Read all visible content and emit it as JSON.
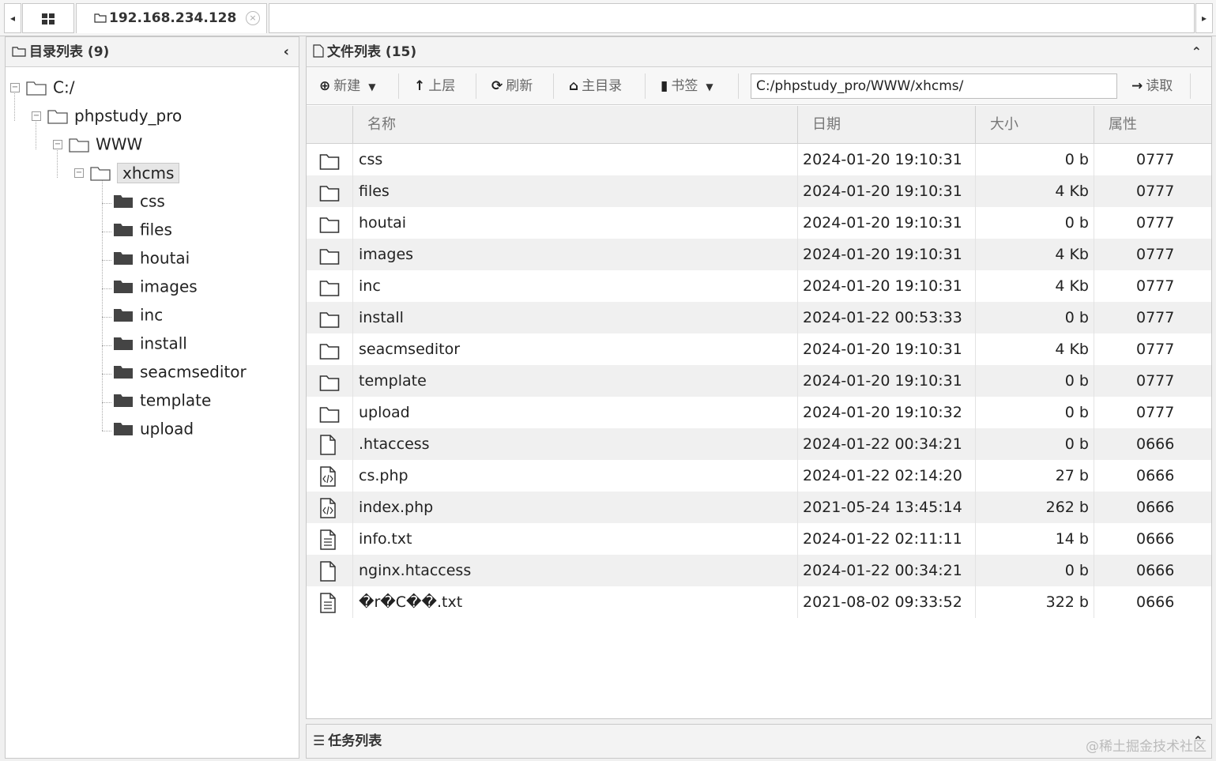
{
  "tabbar": {
    "scroll_left": "◂",
    "scroll_right": "▸",
    "home_icon": "grid-icon",
    "tab_label": "192.168.234.128",
    "tab_close": "×"
  },
  "dir_panel": {
    "title": "目录列表 (9)",
    "collapse": "‹"
  },
  "tree": {
    "root": "C:/",
    "level1": "phpstudy_pro",
    "level2": "WWW",
    "level3": "xhcms",
    "children": [
      "css",
      "files",
      "houtai",
      "images",
      "inc",
      "install",
      "seacmseditor",
      "template",
      "upload"
    ]
  },
  "file_panel": {
    "title": "文件列表 (15)",
    "collapse": "⌃"
  },
  "toolbar": {
    "new_label": "新建",
    "up_label": "上层",
    "refresh_label": "刷新",
    "home_label": "主目录",
    "bookmark_label": "书签",
    "path_value": "C:/phpstudy_pro/WWW/xhcms/",
    "read_label": "读取"
  },
  "columns": {
    "name": "名称",
    "date": "日期",
    "size": "大小",
    "attr": "属性"
  },
  "files": [
    {
      "type": "folder",
      "name": "css",
      "date": "2024-01-20 19:10:31",
      "size": "0 b",
      "attr": "0777"
    },
    {
      "type": "folder",
      "name": "files",
      "date": "2024-01-20 19:10:31",
      "size": "4 Kb",
      "attr": "0777"
    },
    {
      "type": "folder",
      "name": "houtai",
      "date": "2024-01-20 19:10:31",
      "size": "0 b",
      "attr": "0777"
    },
    {
      "type": "folder",
      "name": "images",
      "date": "2024-01-20 19:10:31",
      "size": "4 Kb",
      "attr": "0777"
    },
    {
      "type": "folder",
      "name": "inc",
      "date": "2024-01-20 19:10:31",
      "size": "4 Kb",
      "attr": "0777"
    },
    {
      "type": "folder",
      "name": "install",
      "date": "2024-01-22 00:53:33",
      "size": "0 b",
      "attr": "0777"
    },
    {
      "type": "folder",
      "name": "seacmseditor",
      "date": "2024-01-20 19:10:31",
      "size": "4 Kb",
      "attr": "0777"
    },
    {
      "type": "folder",
      "name": "template",
      "date": "2024-01-20 19:10:31",
      "size": "0 b",
      "attr": "0777"
    },
    {
      "type": "folder",
      "name": "upload",
      "date": "2024-01-20 19:10:32",
      "size": "0 b",
      "attr": "0777"
    },
    {
      "type": "file",
      "name": ".htaccess",
      "date": "2024-01-22 00:34:21",
      "size": "0 b",
      "attr": "0666"
    },
    {
      "type": "code",
      "name": "cs.php",
      "date": "2024-01-22 02:14:20",
      "size": "27 b",
      "attr": "0666"
    },
    {
      "type": "code",
      "name": "index.php",
      "date": "2021-05-24 13:45:14",
      "size": "262 b",
      "attr": "0666"
    },
    {
      "type": "text",
      "name": "info.txt",
      "date": "2024-01-22 02:11:11",
      "size": "14 b",
      "attr": "0666"
    },
    {
      "type": "file",
      "name": "nginx.htaccess",
      "date": "2024-01-22 00:34:21",
      "size": "0 b",
      "attr": "0666"
    },
    {
      "type": "text",
      "name": "�r�C��.txt",
      "date": "2021-08-02 09:33:52",
      "size": "322 b",
      "attr": "0666"
    }
  ],
  "task_panel": {
    "title": "任务列表",
    "watermark": "@稀土掘金技术社区"
  }
}
